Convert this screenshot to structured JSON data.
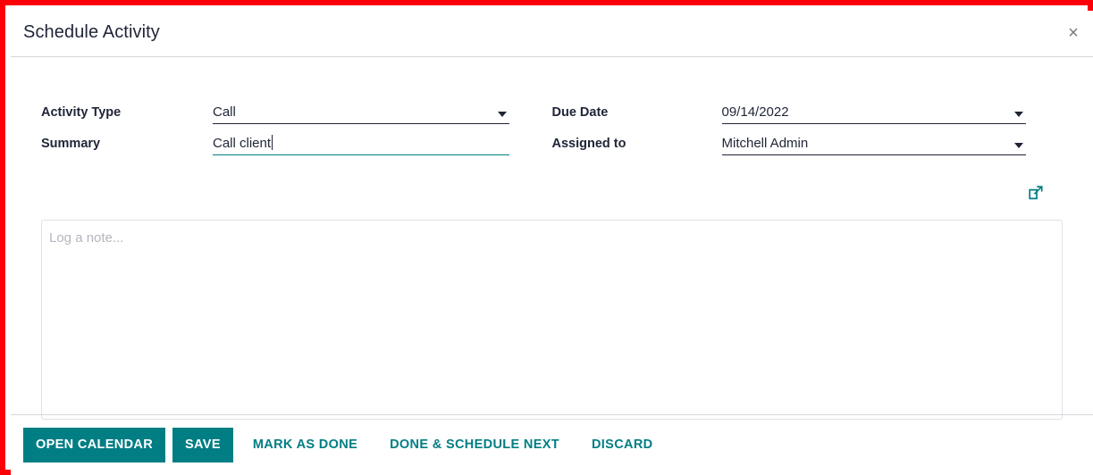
{
  "theme": {
    "accent": "#017e84",
    "highlight_border": "#fb0007",
    "text_dark": "#1f2437",
    "placeholder": "#b3b6bd",
    "divider": "#d3d6dc"
  },
  "header": {
    "title": "Schedule Activity",
    "close_label": "×"
  },
  "form": {
    "activity_type": {
      "label": "Activity Type",
      "value": "Call"
    },
    "summary": {
      "label": "Summary",
      "value": "Call client"
    },
    "due_date": {
      "label": "Due Date",
      "value": "09/14/2022"
    },
    "assigned_to": {
      "label": "Assigned to",
      "value": "Mitchell Admin"
    },
    "note": {
      "placeholder": "Log a note...",
      "value": ""
    }
  },
  "footer": {
    "open_calendar": "OPEN CALENDAR",
    "save": "SAVE",
    "mark_as_done": "MARK AS DONE",
    "done_and_schedule_next": "DONE & SCHEDULE NEXT",
    "discard": "DISCARD"
  }
}
